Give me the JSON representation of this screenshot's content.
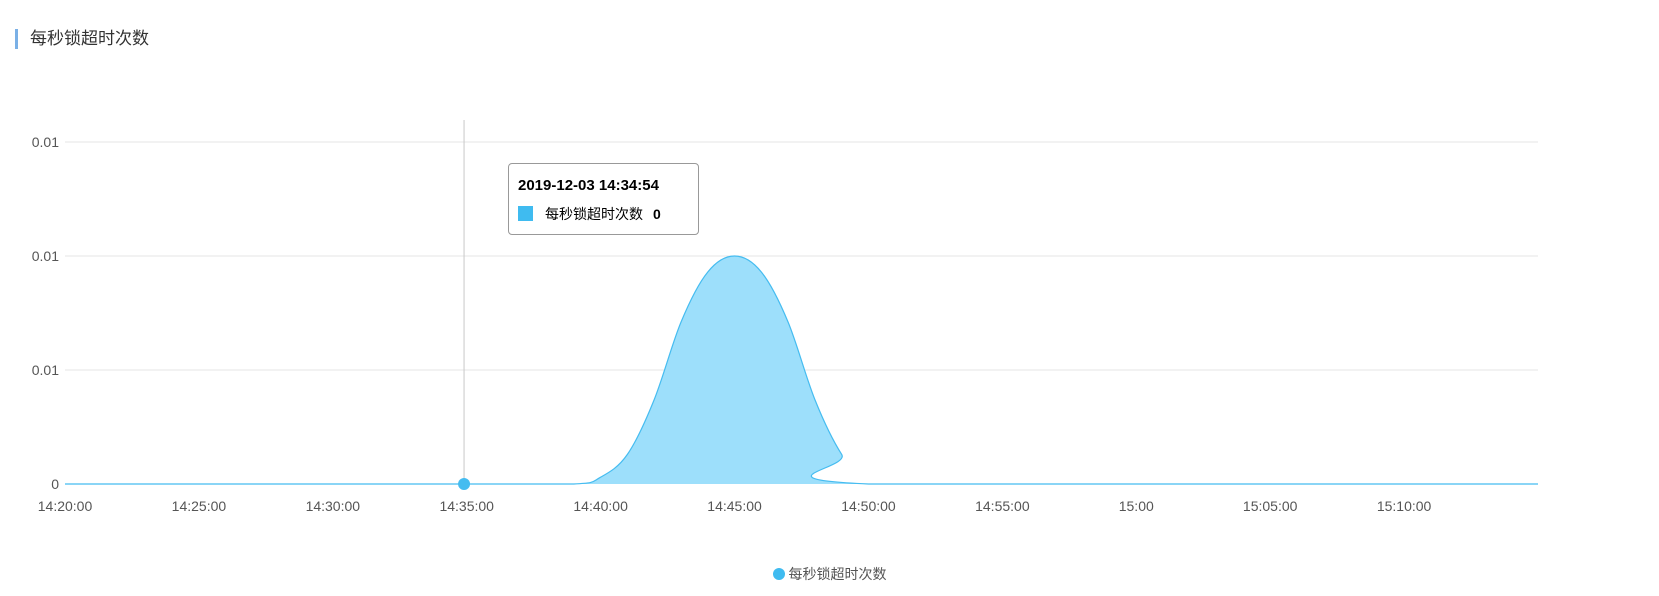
{
  "panel": {
    "title": "每秒锁超时次数"
  },
  "tooltip": {
    "time": "2019-12-03 14:34:54",
    "series_name": "每秒锁超时次数",
    "value": "0"
  },
  "legend": {
    "label": "每秒锁超时次数"
  },
  "colors": {
    "series_line": "#45bcf0",
    "series_fill": "#9ddffb",
    "legend_dot": "#3fbbf0",
    "grid": "#e6e6e6",
    "cursor": "#c8c8c8",
    "title_accent": "#7ab0e6"
  },
  "chart_data": {
    "type": "area",
    "title": "每秒锁超时次数",
    "xlabel": "",
    "ylabel": "",
    "x_ticks": [
      "14:20:00",
      "14:25:00",
      "14:30:00",
      "14:35:00",
      "14:40:00",
      "14:45:00",
      "14:50:00",
      "14:55:00",
      "15:00",
      "15:05:00",
      "15:10:00"
    ],
    "y_tick_labels": [
      "0",
      "0.01",
      "0.01",
      "0.01"
    ],
    "ylim": [
      0,
      0.0015
    ],
    "xlim": [
      "14:20:00",
      "15:15:00"
    ],
    "grid": true,
    "legend_position": "bottom-center",
    "series": [
      {
        "name": "每秒锁超时次数",
        "x": [
          "14:20:00",
          "14:34:54",
          "14:39:00",
          "14:40:00",
          "14:41:00",
          "14:42:00",
          "14:43:00",
          "14:44:00",
          "14:45:00",
          "14:46:00",
          "14:47:00",
          "14:48:00",
          "14:49:00",
          "14:50:00",
          "15:15:00"
        ],
        "values": [
          0,
          0,
          0,
          3e-05,
          0.00013,
          0.00037,
          0.00071,
          0.00093,
          0.001,
          0.00093,
          0.00071,
          0.00037,
          0.00013,
          0,
          0
        ]
      }
    ],
    "cursor": {
      "x": "14:34:54",
      "y": 0
    }
  }
}
